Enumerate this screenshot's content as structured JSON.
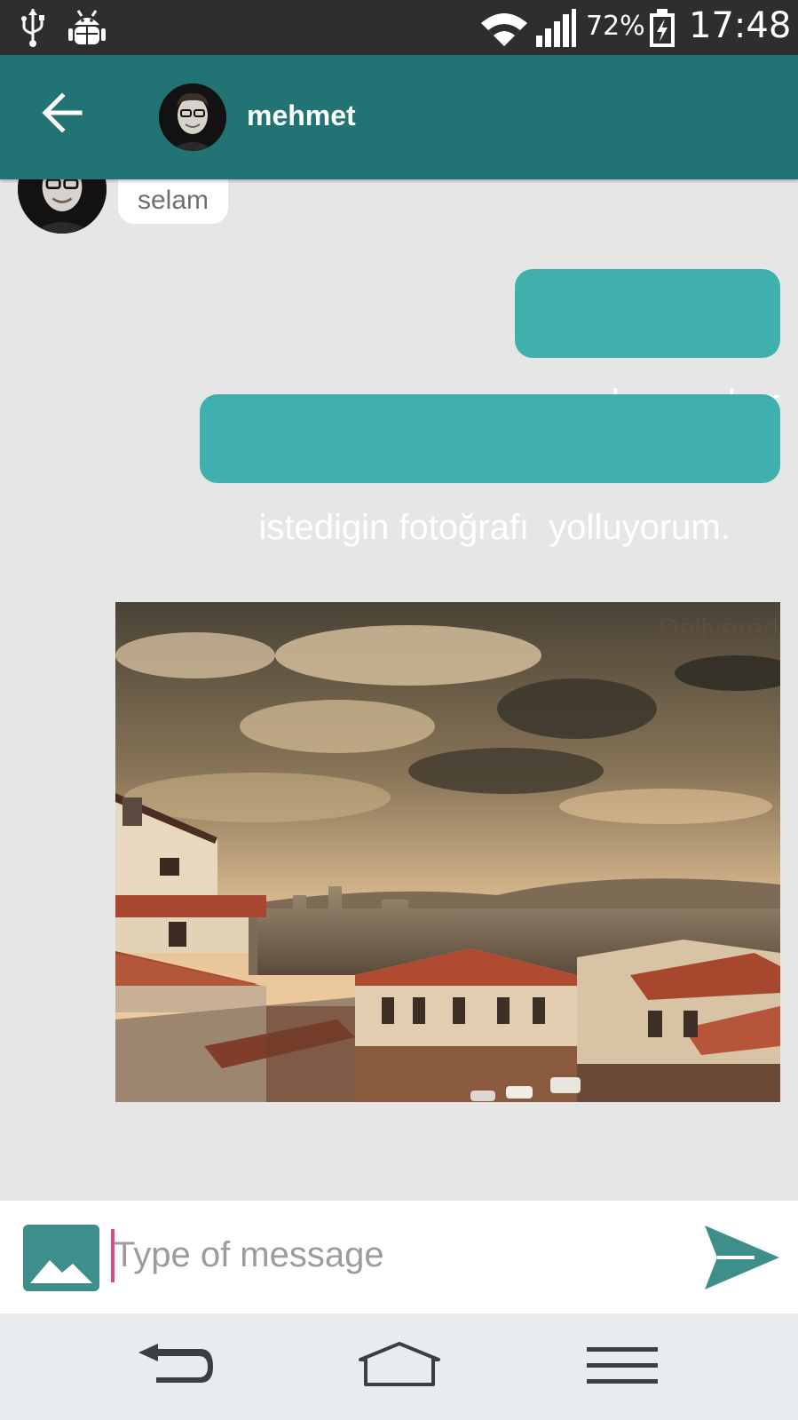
{
  "status_bar": {
    "icons": [
      "usb-icon",
      "android-debug-icon",
      "wifi-icon",
      "signal-icon",
      "battery-charging-icon"
    ],
    "battery": "72%",
    "time": "17:48"
  },
  "header": {
    "back_icon": "arrow-left-icon",
    "contact_name": "mehmet"
  },
  "messages": [
    {
      "direction": "incoming",
      "text": "selam"
    },
    {
      "direction": "outgoing",
      "text": "selam, naber"
    },
    {
      "direction": "outgoing",
      "text": "istedigin fotoğrafı  yolluyorum."
    },
    {
      "direction": "outgoing",
      "type": "image",
      "status": "Delivered"
    }
  ],
  "composer": {
    "image_icon": "image-icon",
    "placeholder": "Type of message",
    "send_icon": "send-icon"
  },
  "nav_bar": {
    "icons": [
      "back-nav-icon",
      "home-nav-icon",
      "menu-nav-icon"
    ]
  },
  "colors": {
    "status_bar": "#2e2e2e",
    "app_bar": "#217374",
    "outgoing_bubble": "#3fb0ad",
    "incoming_bubble": "#ffffff",
    "chat_background": "#e6e6e6",
    "accent": "#3e8f8b",
    "cursor": "#e0457b"
  }
}
